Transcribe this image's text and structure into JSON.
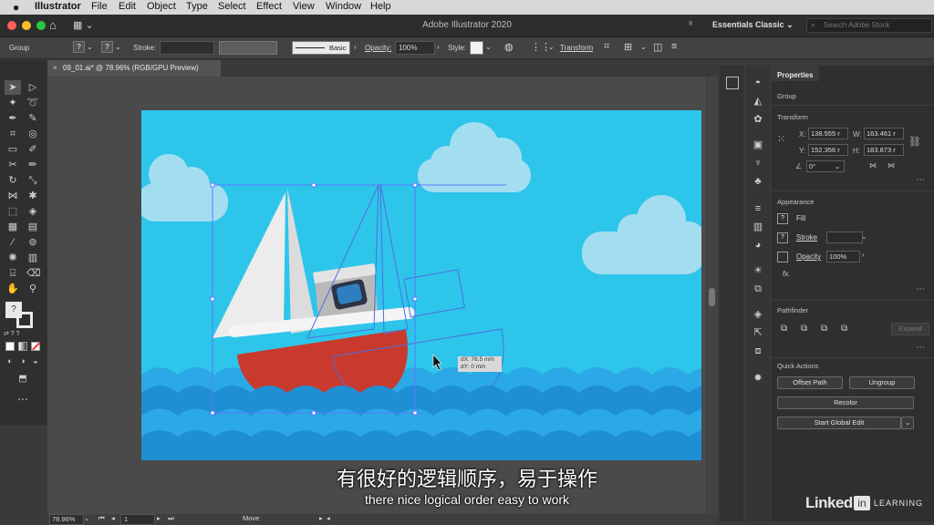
{
  "menubar": {
    "apple": "",
    "app_name": "Illustrator",
    "items": [
      "File",
      "Edit",
      "Object",
      "Type",
      "Select",
      "Effect",
      "View",
      "Window",
      "Help"
    ]
  },
  "appbar": {
    "title": "Adobe Illustrator 2020",
    "workspace": "Essentials Classic",
    "search_placeholder": "Search Adobe Stock"
  },
  "control_bar": {
    "selection_label": "Group",
    "stroke_label": "Stroke:",
    "brush_label": "Basic",
    "opacity_label": "Opacity:",
    "opacity_value": "100%",
    "style_label": "Style:",
    "transform_label": "Transform"
  },
  "document": {
    "tab_title": "09_01.ai* @ 78.96% (RGB/GPU Preview)"
  },
  "canvas": {
    "tooltip_dx": "dX: 76.5 mm",
    "tooltip_dy": "dY: 0 mm",
    "colors": {
      "sky": "#2ec5ea",
      "wave_light": "#2ba9e6",
      "wave_dark": "#1f8fd3",
      "hull": "#c93a2e",
      "sail": "#f0f0f0",
      "cloud": "#a3def0"
    }
  },
  "properties": {
    "title": "Properties",
    "selection": "Group",
    "transform": {
      "heading": "Transform",
      "x_label": "X:",
      "x_value": "138.555 r",
      "y_label": "Y:",
      "y_value": "152.356 r",
      "w_label": "W:",
      "w_value": "163.461 r",
      "h_label": "H:",
      "h_value": "183.873 r",
      "angle_value": "0°"
    },
    "appearance": {
      "heading": "Appearance",
      "fill_label": "Fill",
      "stroke_label": "Stroke",
      "opacity_label": "Opacity",
      "opacity_value": "100%",
      "fx_label": "fx."
    },
    "pathfinder": {
      "heading": "Pathfinder",
      "expand_label": "Expand"
    },
    "quick_actions": {
      "heading": "Quick Actions",
      "offset_path": "Offset Path",
      "ungroup": "Ungroup",
      "recolor": "Recolor",
      "global_edit": "Start Global Edit"
    }
  },
  "status_bar": {
    "zoom": "78.96%",
    "artboard": "1",
    "tool": "Move"
  },
  "subtitles": {
    "chinese": "有很好的逻辑顺序，易于操作",
    "english": "there nice logical order easy to work"
  },
  "watermark": {
    "linked": "Linked",
    "in": "in",
    "learning": "LEARNING"
  }
}
